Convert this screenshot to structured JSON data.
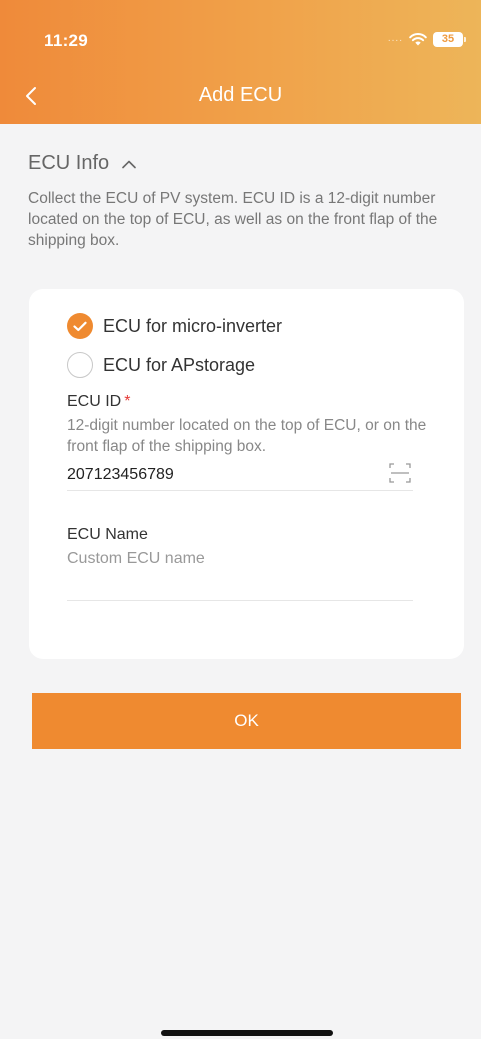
{
  "status_bar": {
    "time": "11:29",
    "signal": "....",
    "battery": "35"
  },
  "nav": {
    "title": "Add ECU",
    "back_icon": "chevron-left-icon"
  },
  "section": {
    "title": "ECU Info",
    "toggle_icon": "chevron-up-icon",
    "description": "Collect the ECU of PV system. ECU ID is a 12-digit number located on the top of ECU, as well as on the front flap of the shipping box."
  },
  "ecu_type": {
    "options": [
      {
        "label": "ECU for micro-inverter",
        "selected": true
      },
      {
        "label": "ECU for APstorage",
        "selected": false
      }
    ]
  },
  "ecu_id": {
    "label": "ECU ID",
    "required_mark": "*",
    "hint": "12-digit number located on the top of ECU, or on the front flap of the shipping box.",
    "value": "207123456789",
    "scan_icon": "scan-icon"
  },
  "ecu_name": {
    "label": "ECU Name",
    "placeholder": "Custom ECU name",
    "value": ""
  },
  "actions": {
    "ok_label": "OK"
  },
  "colors": {
    "accent": "#ef8a30",
    "header_gradient_start": "#ef8a3a",
    "header_gradient_end": "#edb559",
    "required": "#e53935"
  }
}
